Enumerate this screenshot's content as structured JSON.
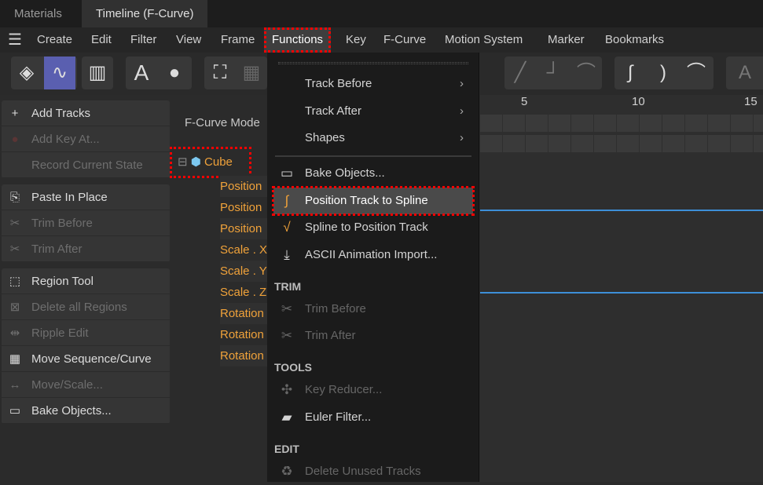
{
  "tabs": [
    "Materials",
    "Timeline (F-Curve)"
  ],
  "menubar": {
    "items": [
      "Create",
      "Edit",
      "Filter",
      "View",
      "Frame",
      "Functions",
      "Key",
      "F-Curve",
      "Motion System",
      "Marker",
      "Bookmarks"
    ],
    "selected": "Functions"
  },
  "left_menu": {
    "groups": [
      [
        {
          "label": "Add Tracks",
          "icon": "plus-icon",
          "enabled": true
        },
        {
          "label": "Add Key At...",
          "icon": "record-icon",
          "enabled": false
        },
        {
          "label": "Record Current State",
          "icon": "",
          "enabled": false
        }
      ],
      [
        {
          "label": "Paste In Place",
          "icon": "paste-icon",
          "enabled": true
        },
        {
          "label": "Trim Before",
          "icon": "scissors-icon",
          "enabled": false
        },
        {
          "label": "Trim After",
          "icon": "scissors-icon",
          "enabled": false
        }
      ],
      [
        {
          "label": "Region Tool",
          "icon": "region-icon",
          "enabled": true
        },
        {
          "label": "Delete all Regions",
          "icon": "delete-region-icon",
          "enabled": false
        },
        {
          "label": "Ripple Edit",
          "icon": "ripple-icon",
          "enabled": false
        },
        {
          "label": "Move Sequence/Curve",
          "icon": "film-icon",
          "enabled": true
        },
        {
          "label": "Move/Scale...",
          "icon": "move-scale-icon",
          "enabled": false
        },
        {
          "label": "Bake Objects...",
          "icon": "bake-icon",
          "enabled": true
        }
      ]
    ]
  },
  "tracks": {
    "mode_label": "F-Curve Mode",
    "object": "Cube",
    "items": [
      "Position",
      "Position",
      "Position",
      "Scale . X",
      "Scale . Y",
      "Scale . Z",
      "Rotation",
      "Rotation",
      "Rotation"
    ]
  },
  "dropdown": {
    "submenus": [
      "Track Before",
      "Track After",
      "Shapes"
    ],
    "items": [
      {
        "label": "Bake Objects...",
        "icon": "bake-icon"
      },
      {
        "label": "Position Track to Spline",
        "icon": "spline-icon",
        "highlighted": true
      },
      {
        "label": "Spline to Position Track",
        "icon": "track-icon"
      },
      {
        "label": "ASCII Animation Import...",
        "icon": "import-icon"
      }
    ],
    "trim_header": "TRIM",
    "trim": [
      "Trim Before",
      "Trim After"
    ],
    "tools_header": "TOOLS",
    "tools": [
      {
        "label": "Key Reducer...",
        "enabled": false
      },
      {
        "label": "Euler Filter...",
        "enabled": true
      }
    ],
    "edit_header": "EDIT",
    "edit": [
      {
        "label": "Delete Unused Tracks",
        "enabled": false
      }
    ]
  },
  "ruler": [
    "5",
    "10",
    "15"
  ],
  "colors": {
    "accent": "#5a5fb0",
    "track_text": "#f0a23a",
    "curve": "#3d8fd8",
    "highlight_outline": "#ff0000"
  }
}
